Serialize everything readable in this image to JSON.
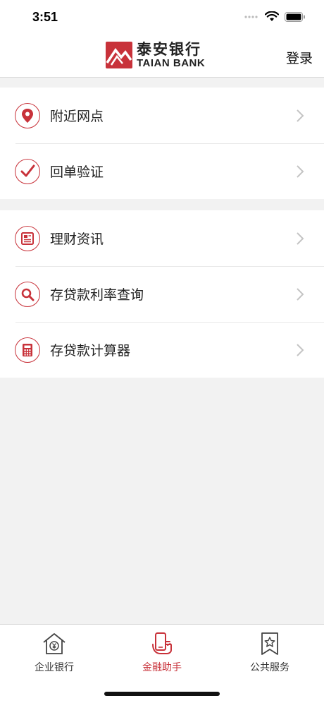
{
  "status_bar": {
    "time": "3:51"
  },
  "header": {
    "logo_cn": "泰安银行",
    "logo_en": "TAIAN BANK",
    "login_label": "登录"
  },
  "groups": [
    {
      "items": [
        {
          "label": "附近网点",
          "icon": "location-pin-icon"
        },
        {
          "label": "回单验证",
          "icon": "check-mark-icon"
        }
      ]
    },
    {
      "items": [
        {
          "label": "理财资讯",
          "icon": "newspaper-icon"
        },
        {
          "label": "存贷款利率查询",
          "icon": "search-icon"
        },
        {
          "label": "存贷款计算器",
          "icon": "calculator-icon"
        }
      ]
    }
  ],
  "tabbar": {
    "tabs": [
      {
        "label": "企业银行",
        "icon": "house-yen-icon",
        "active": false
      },
      {
        "label": "金融助手",
        "icon": "phone-hand-icon",
        "active": true
      },
      {
        "label": "公共服务",
        "icon": "star-ribbon-icon",
        "active": false
      }
    ]
  },
  "colors": {
    "accent": "#c8323a",
    "background": "#f2f2f2"
  }
}
